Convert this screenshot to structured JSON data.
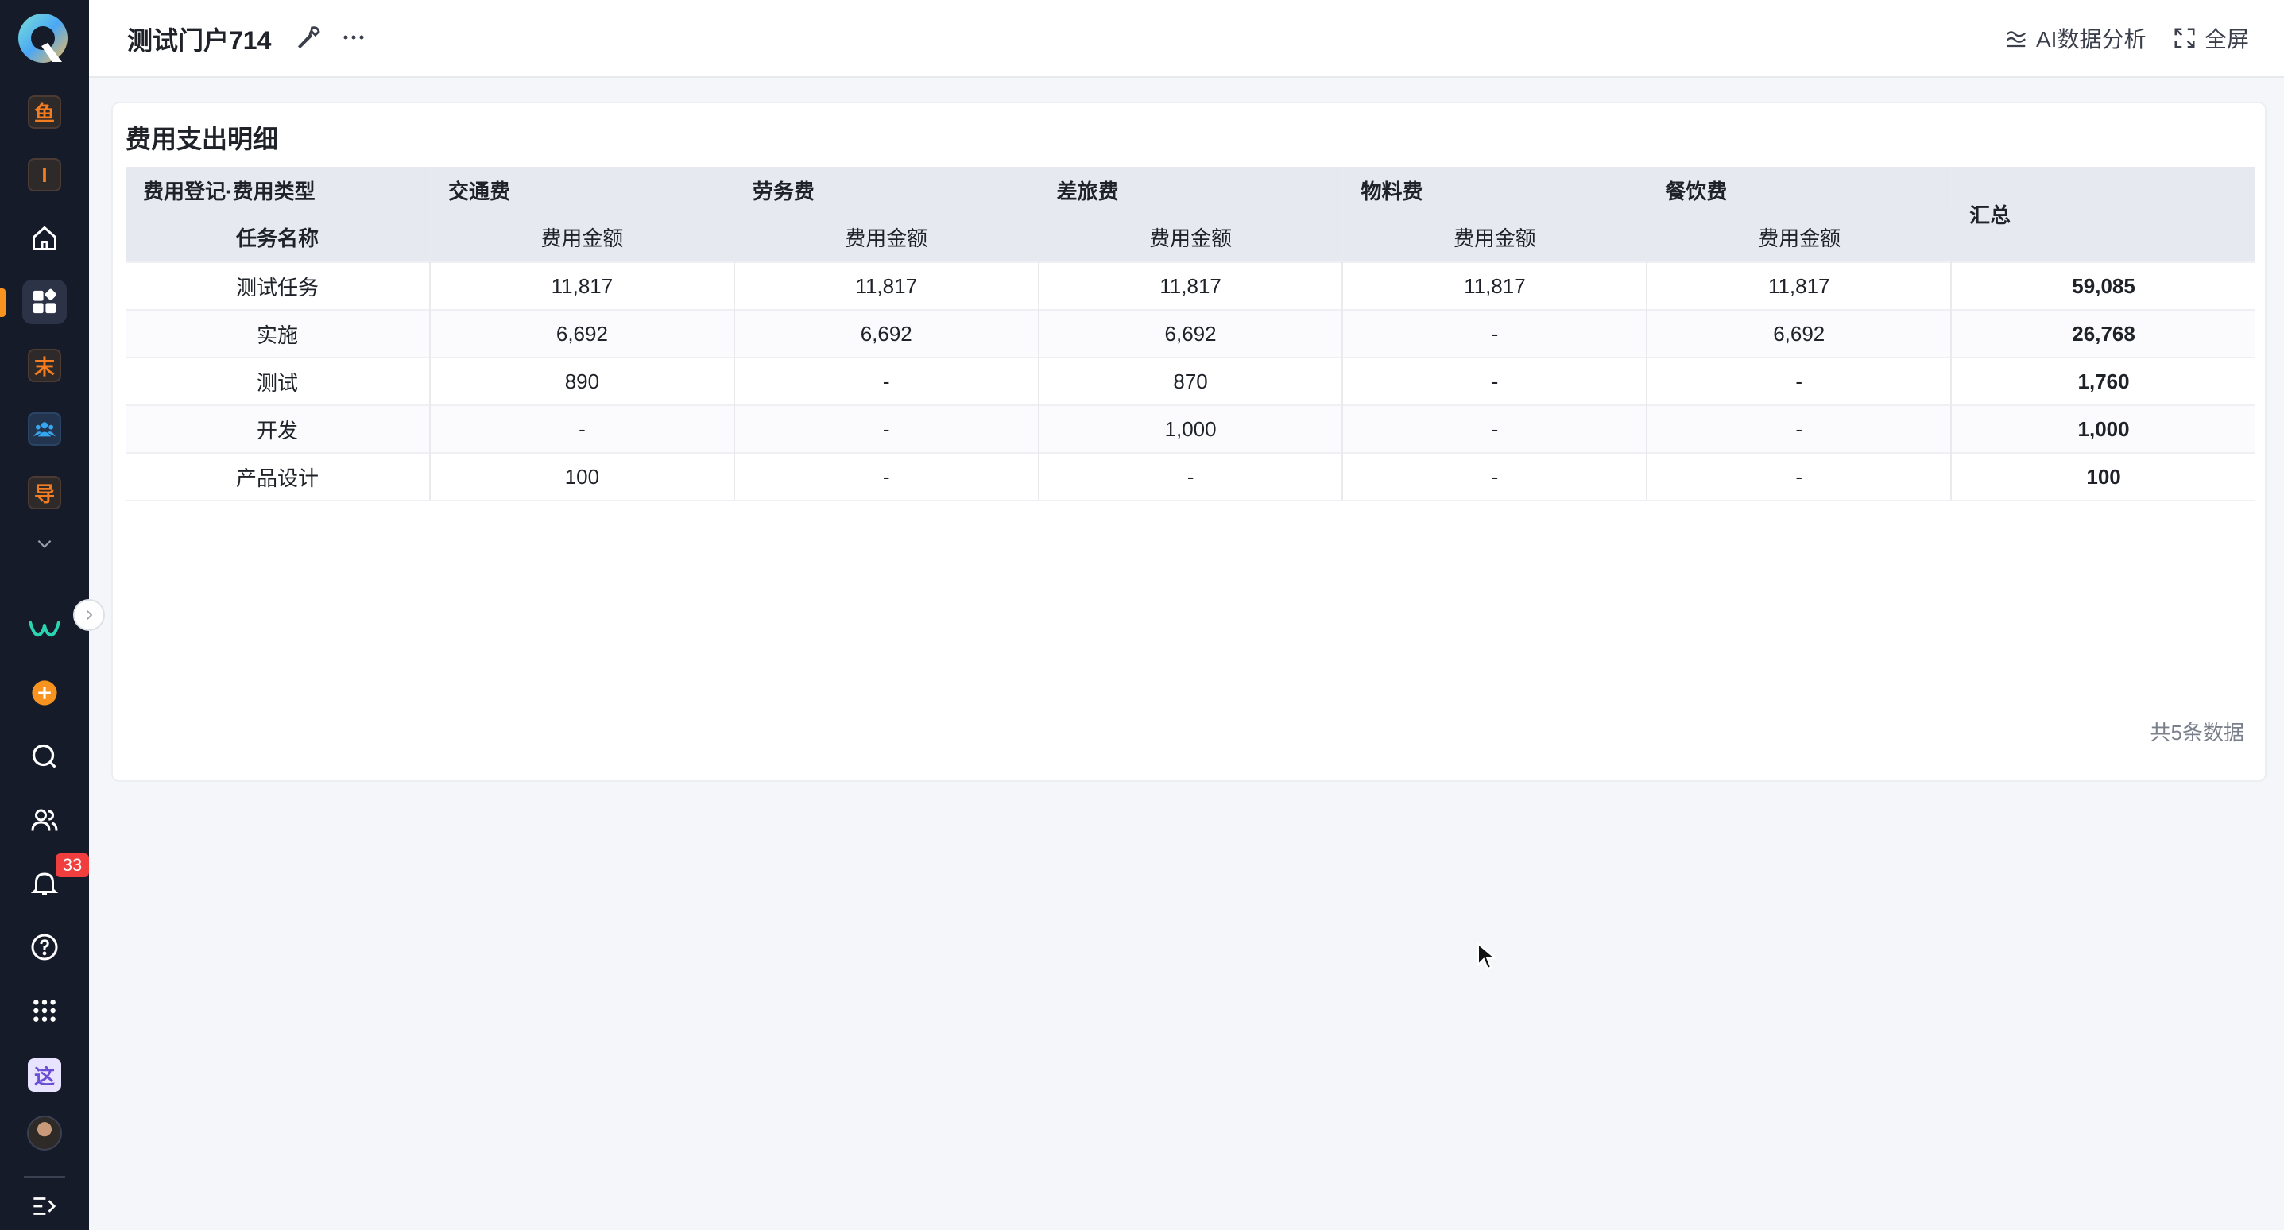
{
  "app": {
    "portal_title": "测试门户714",
    "actions": {
      "ai_analysis": "AI数据分析",
      "fullscreen": "全屏"
    }
  },
  "sidebar": {
    "apps": [
      {
        "name": "yu-app",
        "glyph": "鱼"
      },
      {
        "name": "i-app",
        "glyph": "I"
      },
      {
        "name": "mo-app",
        "glyph": "末"
      },
      {
        "name": "dao-app",
        "glyph": "导"
      },
      {
        "name": "zhe-app",
        "glyph": "这"
      }
    ],
    "notification_count": "33",
    "colors": {
      "accent": "#f7931e",
      "rail": "#161b29",
      "badge": "#f03e3e"
    }
  },
  "report": {
    "title": "费用支出明细",
    "row_dimension_label": "费用登记·费用类型",
    "row_header": "任务名称",
    "columns": [
      {
        "group": "交通费",
        "measure": "费用金额"
      },
      {
        "group": "劳务费",
        "measure": "费用金额"
      },
      {
        "group": "差旅费",
        "measure": "费用金额"
      },
      {
        "group": "物料费",
        "measure": "费用金额"
      },
      {
        "group": "餐饮费",
        "measure": "费用金额"
      }
    ],
    "total_header": "汇总",
    "rows": [
      {
        "task": "测试任务",
        "values": [
          "11,817",
          "11,817",
          "11,817",
          "11,817",
          "11,817"
        ],
        "total": "59,085"
      },
      {
        "task": "实施",
        "values": [
          "6,692",
          "6,692",
          "6,692",
          "-",
          "6,692"
        ],
        "total": "26,768"
      },
      {
        "task": "测试",
        "values": [
          "890",
          "-",
          "870",
          "-",
          "-"
        ],
        "total": "1,760"
      },
      {
        "task": "开发",
        "values": [
          "-",
          "-",
          "1,000",
          "-",
          "-"
        ],
        "total": "1,000"
      },
      {
        "task": "产品设计",
        "values": [
          "100",
          "-",
          "-",
          "-",
          "-"
        ],
        "total": "100"
      }
    ],
    "footer_count": "共5条数据"
  }
}
